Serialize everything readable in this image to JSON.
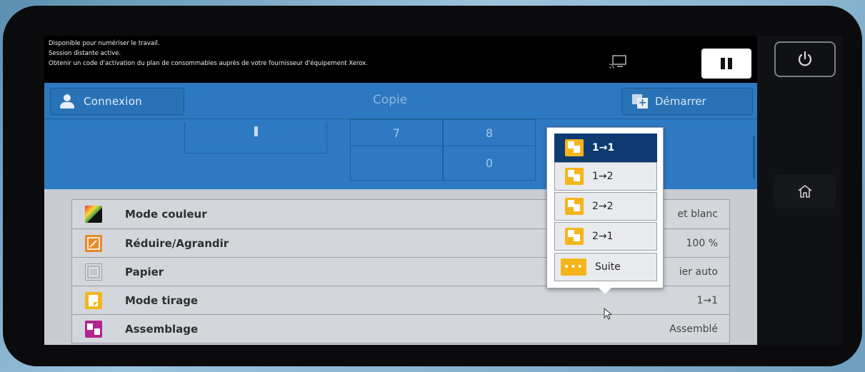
{
  "status": {
    "line1": "Disponible pour numériser le travail.",
    "line2": "Session distante active.",
    "line3": "Obtenir un code d'activation du plan de consommables auprès de votre fournisseur d'équipement Xerox."
  },
  "header": {
    "login_label": "Connexion",
    "title": "Copie",
    "start_label": "Démarrer"
  },
  "keypad": {
    "keys": [
      "7",
      "8",
      "0"
    ]
  },
  "features": [
    {
      "name": "Mode couleur",
      "value": "et blanc",
      "icon": "color-mode-icon"
    },
    {
      "name": "Réduire/Agrandir",
      "value": "100 %",
      "icon": "reduce-enlarge-icon"
    },
    {
      "name": "Papier",
      "value": "ier auto",
      "icon": "paper-icon"
    },
    {
      "name": "Mode tirage",
      "value": "1→1",
      "icon": "duplex-mode-icon"
    },
    {
      "name": "Assemblage",
      "value": "Assemblé",
      "icon": "collation-icon"
    }
  ],
  "popup": {
    "options": [
      "1→1",
      "1→2",
      "2→2",
      "2→1"
    ],
    "selected": "1→1",
    "more_label": "Suite"
  },
  "colors": {
    "accent_blue": "#2d79c1",
    "selected_navy": "#0e3a72",
    "option_icon": "#f4b51c"
  }
}
